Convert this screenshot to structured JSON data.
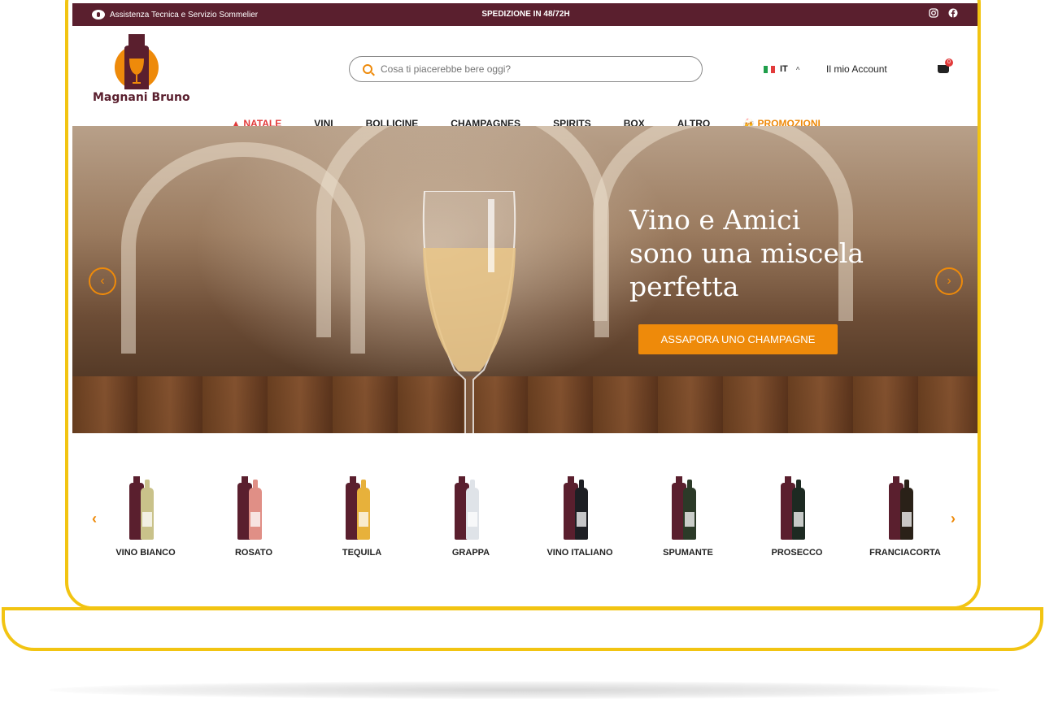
{
  "topbar": {
    "support_text": "Assistenza Tecnica e Servizio Sommelier",
    "shipping_text": "SPEDIZIONE IN 48/72H",
    "social_icons": [
      "instagram-icon",
      "facebook-icon"
    ]
  },
  "header": {
    "logo_text": "Magnani Bruno",
    "search_placeholder": "Cosa ti piacerebbe bere oggi?",
    "language": "IT",
    "account_label": "Il mio Account",
    "cart_count": "0"
  },
  "nav": {
    "items": [
      "NATALE",
      "VINI",
      "BOLLICINE",
      "CHAMPAGNES",
      "SPIRITS",
      "BOX",
      "ALTRO",
      "PROMOZIONI"
    ]
  },
  "hero": {
    "title_line1": "Vino e Amici",
    "title_line2": "sono una miscela",
    "title_line3": "perfetta",
    "button_label": "ASSAPORA UNO CHAMPAGNE"
  },
  "categories": {
    "items": [
      "VINO BIANCO",
      "ROSATO",
      "TEQUILA",
      "GRAPPA",
      "VINO ITALIANO",
      "SPUMANTE",
      "PROSECCO",
      "FRANCIACORTA"
    ]
  },
  "colors": {
    "brand_burgundy": "#5a1f2e",
    "accent_orange": "#ee8a0a",
    "frame_yellow": "#f2c412",
    "alert_red": "#e23b3b"
  }
}
